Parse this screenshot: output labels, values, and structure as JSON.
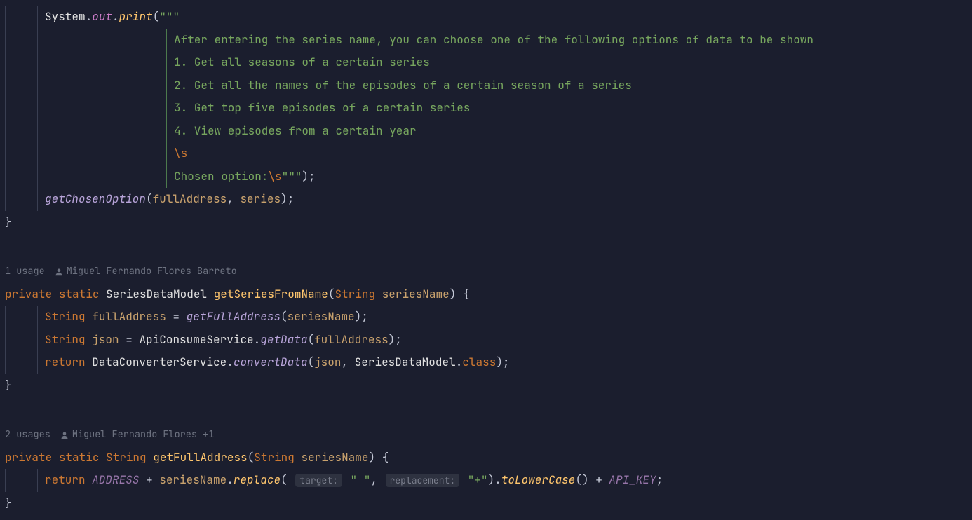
{
  "block1": {
    "line1": {
      "system": "System",
      "dot1": ".",
      "out": "out",
      "dot2": ".",
      "print": "print",
      "open": "(",
      "triple": "\"\"\""
    },
    "ml1": "After entering the series name, you can choose one of the following options of data to be shown",
    "ml2": "1. Get all seasons of a certain series",
    "ml3": "2. Get all the names of the episodes of a certain season of a series",
    "ml4": "3. Get top five episodes of a certain series",
    "ml5": "4. View episodes from a certain year",
    "ml6": "\\s",
    "ml7a": "Chosen option:",
    "ml7b": "\\s",
    "ml7c": "\"\"\"",
    "ml7d": ")",
    "ml7e": ";",
    "call": {
      "name": "getChosenOption",
      "open": "(",
      "arg1": "fullAddress",
      "comma": ", ",
      "arg2": "series",
      "close": ")",
      "semi": ";"
    },
    "closebrace": "}"
  },
  "meta1": {
    "usage": "1 usage",
    "author": "Miguel Fernando Flores Barreto"
  },
  "block2": {
    "sig": {
      "private": "private",
      "static": "static",
      "rettype": "SeriesDataModel",
      "name": "getSeriesFromName",
      "open": "(",
      "ptype": "String",
      "pname": "seriesName",
      "close": ")",
      "brace": " {"
    },
    "l1": {
      "type": "String",
      "var": "fullAddress",
      "eq": " = ",
      "call": "getFullAddress",
      "open": "(",
      "arg": "seriesName",
      "close": ")",
      "semi": ";"
    },
    "l2": {
      "type": "String",
      "var": "json",
      "eq": " = ",
      "cls": "ApiConsumeService",
      "dot": ".",
      "call": "getData",
      "open": "(",
      "arg": "fullAddress",
      "close": ")",
      "semi": ";"
    },
    "l3": {
      "ret": "return",
      "cls": "DataConverterService",
      "dot": ".",
      "call": "convertData",
      "open": "(",
      "arg1": "json",
      "comma": ", ",
      "cls2": "SeriesDataModel",
      "dot2": ".",
      "classkw": "class",
      "close": ")",
      "semi": ";"
    },
    "closebrace": "}"
  },
  "meta2": {
    "usage": "2 usages",
    "author": "Miguel Fernando Flores +1"
  },
  "block3": {
    "sig": {
      "private": "private",
      "static": "static",
      "rettype": "String",
      "name": "getFullAddress",
      "open": "(",
      "ptype": "String",
      "pname": "seriesName",
      "close": ")",
      "brace": " {"
    },
    "l1": {
      "ret": "return",
      "const1": "ADDRESS",
      "plus1": " + ",
      "var": "seriesName",
      "dot1": ".",
      "call1": "replace",
      "open": "(",
      "hint1": "target:",
      "str1": "\" \"",
      "comma": ", ",
      "hint2": "replacement:",
      "str2": "\"+\"",
      "close1": ")",
      "dot2": ".",
      "call2": "toLowerCase",
      "open2": "(",
      "close2": ")",
      "plus2": " + ",
      "const2": "API_KEY",
      "semi": ";"
    },
    "closebrace": "}"
  }
}
